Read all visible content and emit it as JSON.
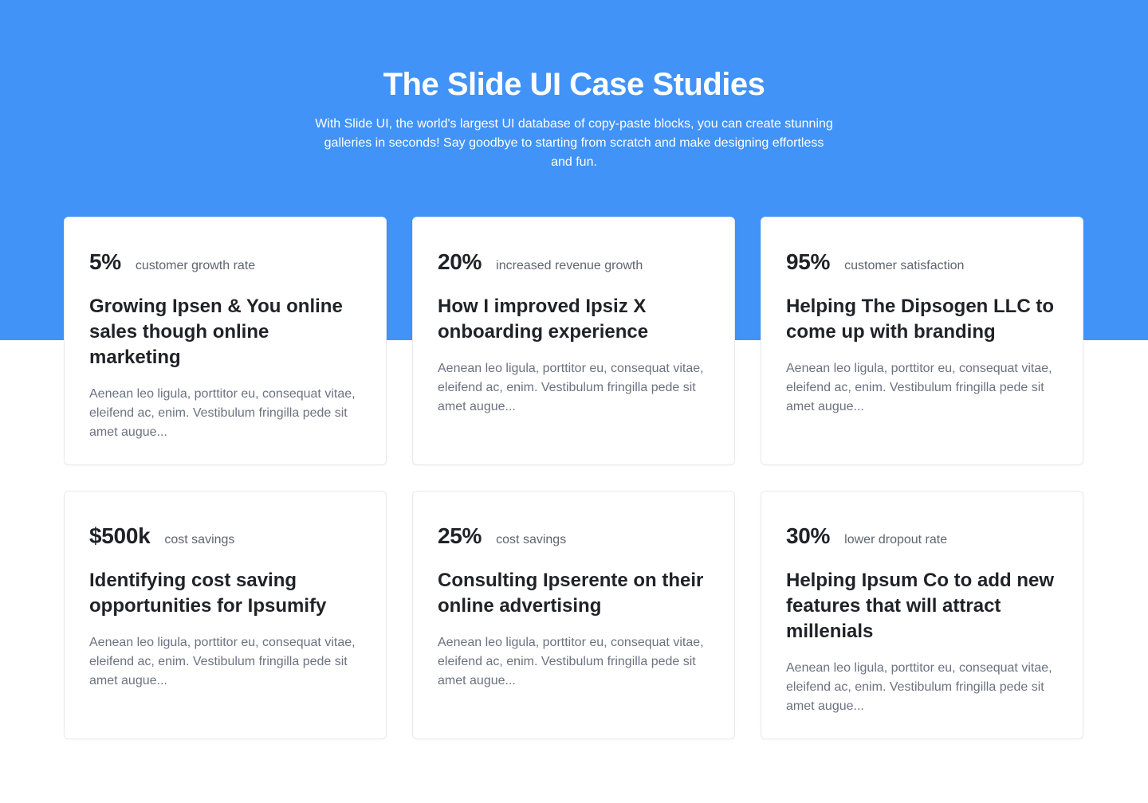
{
  "header": {
    "title": "The Slide UI Case Studies",
    "subtitle": "With Slide UI, the world's largest UI database of copy-paste blocks, you can create stunning galleries in seconds! Say goodbye to starting from scratch and make designing effortless and fun."
  },
  "colors": {
    "hero_background": "#4193F7",
    "text_primary": "#1f2328",
    "text_secondary": "#6b7280"
  },
  "cards": [
    {
      "stat": "5%",
      "stat_label": "customer growth rate",
      "title": "Growing Ipsen & You online sales though online marketing",
      "body": "Aenean leo ligula, porttitor eu, consequat vitae, eleifend ac, enim. Vestibulum fringilla pede sit amet augue..."
    },
    {
      "stat": "20%",
      "stat_label": "increased revenue growth",
      "title": "How I improved Ipsiz X onboarding experience",
      "body": "Aenean leo ligula, porttitor eu, consequat vitae, eleifend ac, enim. Vestibulum fringilla pede sit amet augue..."
    },
    {
      "stat": "95%",
      "stat_label": "customer satisfaction",
      "title": "Helping The Dipsogen LLC to come up with branding",
      "body": "Aenean leo ligula, porttitor eu, consequat vitae, eleifend ac, enim. Vestibulum fringilla pede sit amet augue..."
    },
    {
      "stat": "$500k",
      "stat_label": "cost savings",
      "title": "Identifying cost saving opportunities for Ipsumify",
      "body": "Aenean leo ligula, porttitor eu, consequat vitae, eleifend ac, enim. Vestibulum fringilla pede sit amet augue..."
    },
    {
      "stat": "25%",
      "stat_label": "cost savings",
      "title": "Consulting Ipserente on their online advertising",
      "body": "Aenean leo ligula, porttitor eu, consequat vitae, eleifend ac, enim. Vestibulum fringilla pede sit amet augue..."
    },
    {
      "stat": "30%",
      "stat_label": "lower dropout rate",
      "title": "Helping Ipsum Co to add new features that will attract millenials",
      "body": "Aenean leo ligula, porttitor eu, consequat vitae, eleifend ac, enim. Vestibulum fringilla pede sit amet augue..."
    }
  ]
}
